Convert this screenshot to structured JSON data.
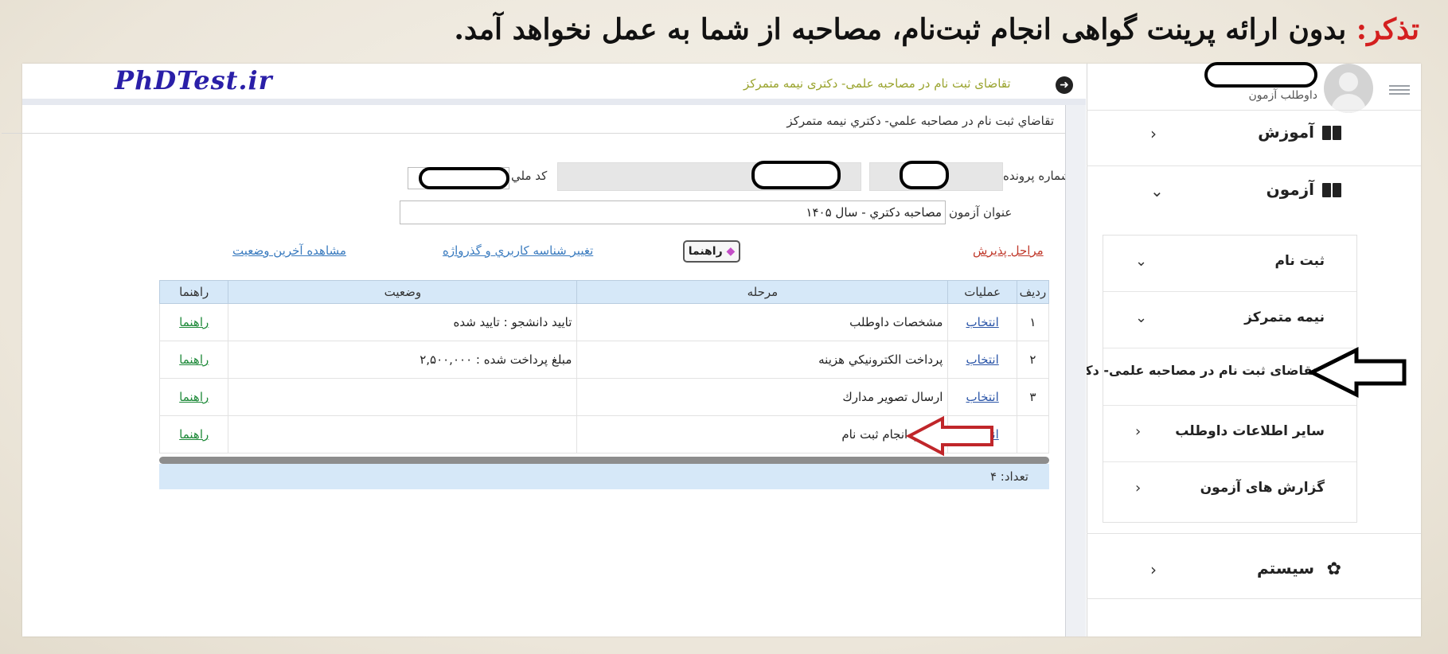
{
  "headline": {
    "prefix": "تذکر:",
    "text": "بدون ارائه پرینت گواهی انجام ثبت‌نام، مصاحبه از شما به عمل نخواهد آمد."
  },
  "sidebar": {
    "user_role": "داوطلب آزمون",
    "menu": [
      {
        "label": "آموزش",
        "icon": "book-icon",
        "chevron": "‹"
      },
      {
        "label": "آزمون",
        "icon": "book-icon",
        "chevron": "⌄"
      },
      {
        "label": "سیستم",
        "icon": "gear-icon",
        "chevron": "‹"
      }
    ],
    "submenu": [
      {
        "label": "ثبت نام",
        "chevron": "⌄"
      },
      {
        "label": "نیمه متمرکز",
        "chevron": "⌄"
      },
      {
        "label": "تقاضای ثبت نام در مصاحبه علمی- دکتری نیمه متمرکز"
      },
      {
        "label": "سایر اطلاعات داوطلب",
        "chevron": "‹"
      },
      {
        "label": "گزارش های آزمون",
        "chevron": "‹"
      }
    ]
  },
  "topbar": {
    "brand": "PhDTest.ir",
    "breadcrumb": "تقاضای ثبت نام در مصاحبه علمی- دکتری نیمه متمرکز"
  },
  "page": {
    "title": "تقاضاي ثبت نام در مصاحبه علمي- دكتري نيمه متمركز",
    "file_number_label": "شماره پرونده",
    "national_id_label": "كد ملي",
    "exam_title_label": "عنوان آزمون",
    "exam_title_value": "مصاحبه دکتري - سال ۱۴۰۵",
    "steps_link": "مراحل پذيرش",
    "help_button": "راهنما",
    "change_credentials_link": "تغيير شناسه كاربري و گذرواژه",
    "last_status_link": "مشاهده آخرين وضعيت"
  },
  "table": {
    "headers": [
      "رديف",
      "عمليات",
      "مرحله",
      "وضعيت",
      "راهنما"
    ],
    "rows": [
      {
        "num": "۱",
        "op": "انتخاب",
        "stage": "مشخصات داوطلب",
        "status": "تاييد دانشجو : تاييد شده",
        "help": "راهنما"
      },
      {
        "num": "۲",
        "op": "انتخاب",
        "stage": "پرداخت الكترونيكي هزينه",
        "status": "مبلغ پرداخت شده : ۲,۵۰۰,۰۰۰",
        "help": "راهنما"
      },
      {
        "num": "۳",
        "op": "انتخاب",
        "stage": "ارسال تصوير مدارك",
        "status": "",
        "help": "راهنما"
      },
      {
        "num": "",
        "op": "انتخاب",
        "stage": "گواهي انجام ثبت نام",
        "status": "",
        "help": "راهنما"
      }
    ],
    "count": "تعداد: ۴"
  },
  "colors": {
    "accent_red": "#d41f1f",
    "brand_blue": "#2a1fa8",
    "table_header": "#d6e8f8",
    "arrow_red": "#c0262a"
  }
}
